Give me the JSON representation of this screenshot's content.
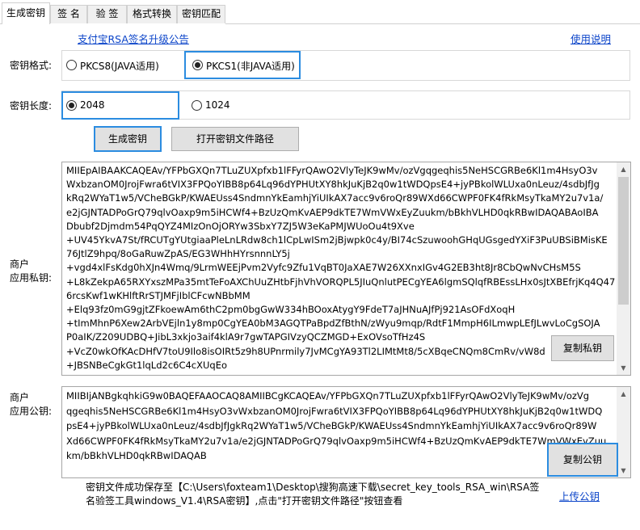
{
  "tabs": [
    {
      "label": "生成密钥"
    },
    {
      "label": "签 名"
    },
    {
      "label": "验 签"
    },
    {
      "label": "格式转换"
    },
    {
      "label": "密钥匹配"
    }
  ],
  "links": {
    "announcement": "支付宝RSA签名升级公告",
    "help": "使用说明",
    "upload": "上传公钥"
  },
  "key_format": {
    "label": "密钥格式:",
    "options": [
      {
        "label": "PKCS8(JAVA适用)",
        "selected": false
      },
      {
        "label": "PKCS1(非JAVA适用)",
        "selected": true
      }
    ]
  },
  "key_length": {
    "label": "密钥长度:",
    "options": [
      {
        "label": "2048",
        "selected": true
      },
      {
        "label": "1024",
        "selected": false
      }
    ]
  },
  "buttons": {
    "generate": "生成密钥",
    "open_path": "打开密钥文件路径",
    "copy_private": "复制私钥",
    "copy_public": "复制公钥"
  },
  "private_key": {
    "label_line1": "商户",
    "label_line2": "应用私钥:",
    "lines": [
      "MIIEpAIBAAKCAQEAv/YFPbGXQn7TLuZUXpfxb1lFFyrQAwO2VlyTeJK9wMv/ozVgqgeqhis5NeHSCGRBe6Kl1m4HsyO3v",
      "WxbzanOM0JrojFwra6tVIX3FPQoYIBB8p64Lq96dYPHUtXY8hkJuKjB2q0w1tWDQpsE4+jyPBkolWLUxa0nLeuz/4sdbJfJg",
      "kRq2WYaT1w5/VCheBGkP/KWAEUss4SndmnYkEamhjYiUIkAX7acc9v6roQr89WXd66CWPF0FK4fRkMsyTkaMY2u7v1a/",
      "e2jGJNTADPoGrQ79qlvOaxp9m5iHCWf4+BzUzQmKvAEP9dkTE7WmVWxEyZuukm/bBkhVLHD0qkRBwIDAQABAoIBA",
      "Dbubf2Djmdm54PqQYZ4MIzOnOjORYw3SbxY7ZJ5W3eKaPMJWUoOu4t9Xve",
      "+UV45YkvA7St/fRCUTgYUtgiaaPleLnLRdw8ch1lCpLwISm2jBjwpk0c4y/BI74cSzuwoohGHqUGsgedYXiF3PuUBSiBMisKE",
      "76JtlZ9hpq/8oGaRuwZpAS/EG3WHhHYrsnnnLY5j",
      "+vgd4xlFsKdg0hXJn4Wmq/9LrmWEEjPvm2Vyfc9Zfu1VqBT0JaXAE7W26XXnxIGv4G2EB3ht8Jr8CbQwNvCHsM5S",
      "+L8kZekpA65RXYxszMPa35mtTeFoAXChUuZHtbFjhVhVORQPL5JIuQnlutPECgYEA6lgmSQlqfRBEssLHx0sJtXBEfrjKq4Q47",
      "6rcsKwf1wKHlftRrSTJMFjIblCFcwNBbMM",
      "+Elq93fz0mG9gjtZFkoewAm6thC2pm0bgGwW334hBOoxAtygY9FdeT7aJHNuAJfPj921AsOFdXoqH",
      "+tImMhnP6Xew2ArbVEjln1y8mp0CgYEA0bM3AGQTPaBpdZfBthN/zWyu9mqp/RdtF1MmpH6ILmwpLEfJLwvLoCgSOJA",
      "P0aIK/Z209UDBQ+JibL3xkjo3aif4klA9r7gwTAPGIVzyQCZMGD+ExOVsoTfHz4S",
      "+VcZ0wkOfKAcDHfV7toU9Ilo8isOIRt5z9h8UPnrmily7JvMCgYA93Tl2LIMtMt8/5cXBqeCNQm8CmRv/vW8d",
      "+JBSNBeCgkGt1lqLd2c6C4cXUqEo"
    ]
  },
  "public_key": {
    "label_line1": "商户",
    "label_line2": "应用公钥:",
    "lines": [
      "MIIBIjANBgkqhkiG9w0BAQEFAAOCAQ8AMIIBCgKCAQEAv/YFPbGXQn7TLuZUXpfxb1lFFyrQAwO2VlyTeJK9wMv/ozVg",
      "qgeqhis5NeHSCGRBe6Kl1m4HsyO3vWxbzanOM0JrojFwra6tVIX3FPQoYIBB8p64Lq96dYPHUtXY8hkJuKjB2q0w1tWDQ",
      "psE4+jyPBkolWLUxa0nLeuz/4sdbJfJgkRq2WYaT1w5/VCheBGkP/KWAEUss4SndmnYkEamhjYiUIkAX7acc9v6roQr89W",
      "Xd66CWPF0FK4fRkMsyTkaMY2u7v1a/e2jGJNTADPoGrQ79qlvOaxp9m5iHCWf4+BzUzQmKvAEP9dkTE7WmVWxEyZuu",
      "km/bBkhVLHD0qkRBwIDAQAB"
    ]
  },
  "status": {
    "line1": "密钥文件成功保存至【C:\\Users\\foxteam1\\Desktop\\搜狗高速下载\\secret_key_tools_RSA_win\\RSA签",
    "line2": "名验签工具windows_V1.4\\RSA密钥】,点击\"打开密钥文件路径\"按钮查看"
  },
  "colors": {
    "highlight": "#2b8ce0",
    "link": "#0b44c9"
  }
}
